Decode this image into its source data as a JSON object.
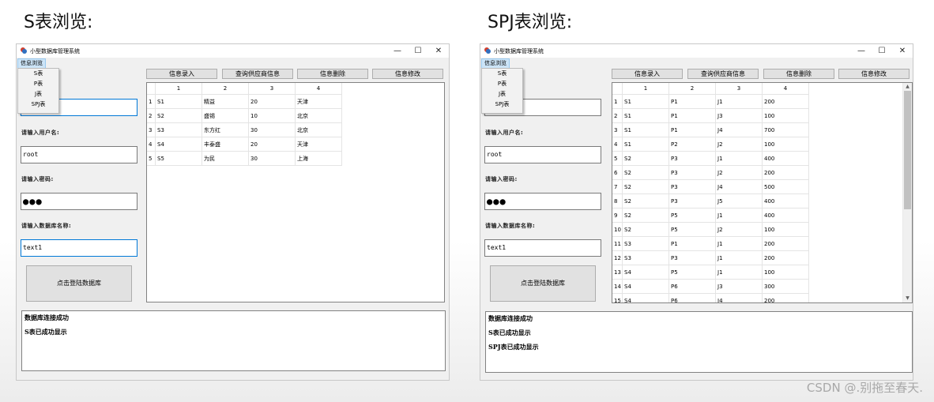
{
  "headings": {
    "left": "S表浏览:",
    "right": "SPJ表浏览:"
  },
  "window": {
    "title": "小型数据库管理系统",
    "menu": "信息浏览",
    "menu_items": [
      "S表",
      "P表",
      "J表",
      "SPJ表"
    ],
    "controls": {
      "minimize": "—",
      "maximize": "☐",
      "close": "✕"
    },
    "labels": {
      "username": "请输入用户名:",
      "password": "请输入密码:",
      "database": "请输入数据库名称:"
    },
    "values": {
      "username": "root",
      "password": "●●●",
      "database": "text1"
    },
    "login_button": "点击登陆数据库",
    "toolbar": [
      "信息录入",
      "查询供应商信息",
      "信息删除",
      "信息修改"
    ],
    "columns": [
      "1",
      "2",
      "3",
      "4"
    ]
  },
  "left": {
    "rows": [
      [
        "1",
        "S1",
        "精益",
        "20",
        "天津"
      ],
      [
        "2",
        "S2",
        "盛锡",
        "10",
        "北京"
      ],
      [
        "3",
        "S3",
        "东方红",
        "30",
        "北京"
      ],
      [
        "4",
        "S4",
        "丰泰盛",
        "20",
        "天津"
      ],
      [
        "5",
        "S5",
        "为民",
        "30",
        "上海"
      ]
    ],
    "log": [
      "数据库连接成功",
      "S表已成功显示"
    ]
  },
  "right": {
    "rows": [
      [
        "1",
        "S1",
        "P1",
        "J1",
        "200"
      ],
      [
        "2",
        "S1",
        "P1",
        "J3",
        "100"
      ],
      [
        "3",
        "S1",
        "P1",
        "J4",
        "700"
      ],
      [
        "4",
        "S1",
        "P2",
        "J2",
        "100"
      ],
      [
        "5",
        "S2",
        "P3",
        "J1",
        "400"
      ],
      [
        "6",
        "S2",
        "P3",
        "J2",
        "200"
      ],
      [
        "7",
        "S2",
        "P3",
        "J4",
        "500"
      ],
      [
        "8",
        "S2",
        "P3",
        "J5",
        "400"
      ],
      [
        "9",
        "S2",
        "P5",
        "J1",
        "400"
      ],
      [
        "10",
        "S2",
        "P5",
        "J2",
        "100"
      ],
      [
        "11",
        "S3",
        "P1",
        "J1",
        "200"
      ],
      [
        "12",
        "S3",
        "P3",
        "J1",
        "200"
      ],
      [
        "13",
        "S4",
        "P5",
        "J1",
        "100"
      ],
      [
        "14",
        "S4",
        "P6",
        "J3",
        "300"
      ],
      [
        "15",
        "S4",
        "P6",
        "J4",
        "200"
      ]
    ],
    "log": [
      "数据库连接成功",
      "S表已成功显示",
      "SPJ表已成功显示"
    ]
  },
  "watermark": "CSDN @.别拖至春天."
}
